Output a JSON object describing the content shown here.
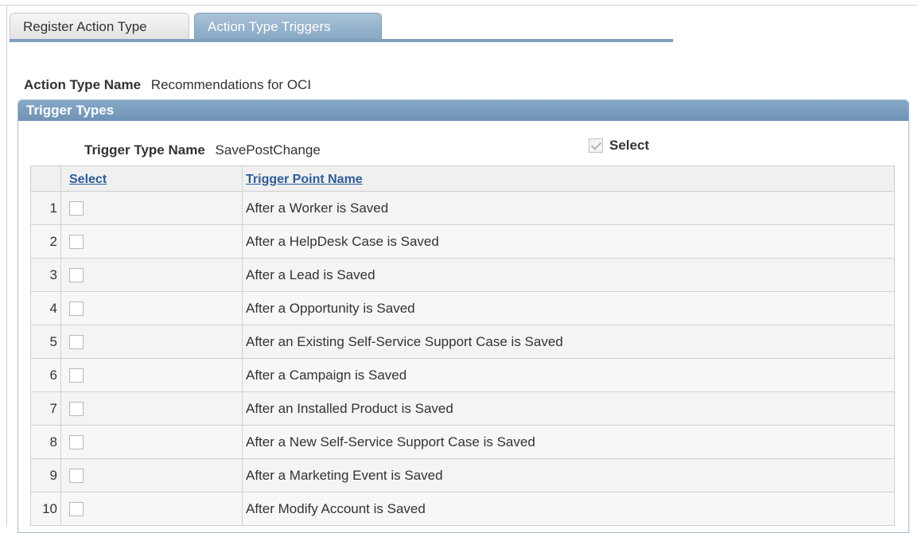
{
  "tabs": [
    {
      "label": "Register Action Type",
      "active": false
    },
    {
      "label": "Action Type Triggers",
      "active": true
    }
  ],
  "action_type": {
    "label": "Action Type Name",
    "value": "Recommendations for OCI"
  },
  "group": {
    "title": "Trigger Types",
    "trigger_type_label": "Trigger Type Name",
    "trigger_type_value": "SavePostChange",
    "select_all_label": "Select",
    "select_all_checked": true
  },
  "grid": {
    "headers": {
      "select": "Select",
      "name": "Trigger Point Name"
    },
    "rows": [
      {
        "num": "1",
        "name": "After a Worker is Saved",
        "checked": false
      },
      {
        "num": "2",
        "name": "After a HelpDesk Case is Saved",
        "checked": false
      },
      {
        "num": "3",
        "name": "After a Lead is Saved",
        "checked": false
      },
      {
        "num": "4",
        "name": "After a Opportunity is Saved",
        "checked": false
      },
      {
        "num": "5",
        "name": "After an Existing Self-Service Support Case is Saved",
        "checked": false
      },
      {
        "num": "6",
        "name": "After a Campaign is Saved",
        "checked": false
      },
      {
        "num": "7",
        "name": "After an Installed Product is Saved",
        "checked": false
      },
      {
        "num": "8",
        "name": "After a New Self-Service Support Case is Saved",
        "checked": false
      },
      {
        "num": "9",
        "name": "After a Marketing Event is Saved",
        "checked": false
      },
      {
        "num": "10",
        "name": "After Modify Account is Saved",
        "checked": false
      }
    ]
  },
  "colors": {
    "tab_active": "#87a8c4",
    "group_header": "#6f93b6",
    "link": "#2d5d9b"
  }
}
